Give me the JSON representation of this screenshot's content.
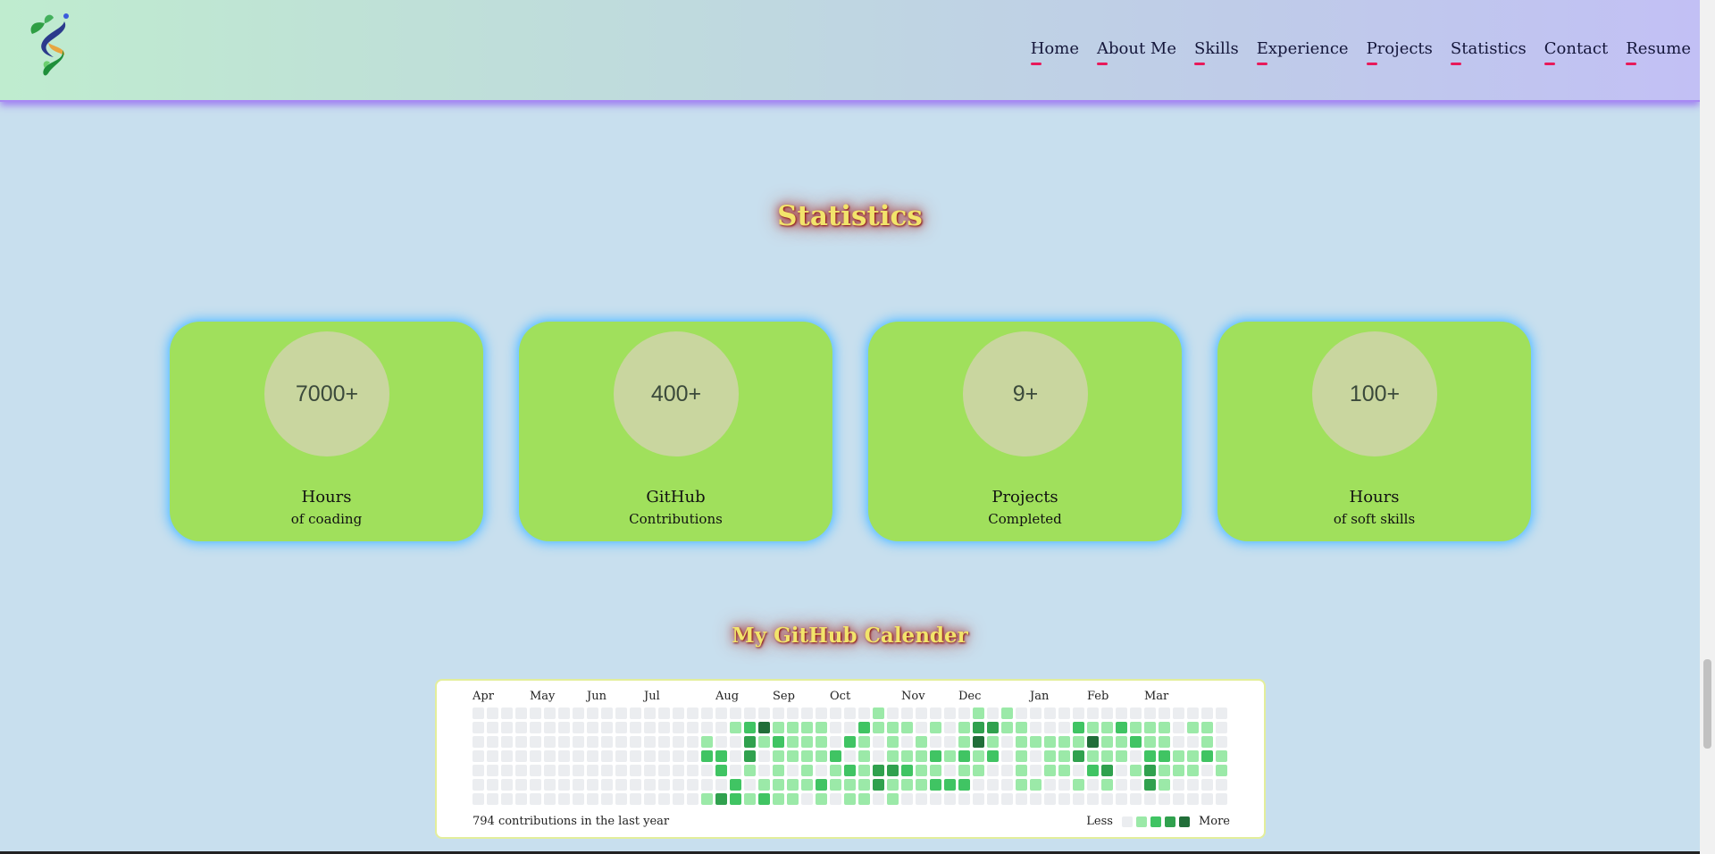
{
  "nav": {
    "items": [
      "Home",
      "About Me",
      "Skills",
      "Experience",
      "Projects",
      "Statistics",
      "Contact",
      "Resume"
    ]
  },
  "statistics": {
    "title": "Statistics",
    "cards": [
      {
        "value": "7000+",
        "title": "Hours",
        "sub": "of coading"
      },
      {
        "value": "400+",
        "title": "GitHub",
        "sub": "Contributions"
      },
      {
        "value": "9+",
        "title": "Projects",
        "sub": "Completed"
      },
      {
        "value": "100+",
        "title": "Hours",
        "sub": "of soft skills"
      }
    ]
  },
  "calendar": {
    "title": "My GitHub Calender",
    "months": [
      "Apr",
      "May",
      "Jun",
      "Jul",
      "Aug",
      "Sep",
      "Oct",
      "Nov",
      "Dec",
      "Jan",
      "Feb",
      "Mar"
    ],
    "month_weeks": [
      0,
      4,
      8,
      12,
      17,
      21,
      25,
      30,
      34,
      39,
      43,
      47
    ],
    "summary": "794 contributions in the last year",
    "legend_less": "Less",
    "legend_more": "More",
    "colors": [
      "#ebedf0",
      "#9be9a8",
      "#40c463",
      "#30a14e",
      "#216e39"
    ],
    "active_weeks_pattern": [
      [
        0,
        0,
        0,
        0,
        0,
        0,
        0
      ],
      [
        0,
        0,
        0,
        0,
        0,
        0,
        0
      ],
      [
        0,
        0,
        0,
        0,
        0,
        0,
        0
      ],
      [
        0,
        0,
        0,
        0,
        0,
        0,
        0
      ],
      [
        0,
        0,
        0,
        0,
        0,
        0,
        0
      ],
      [
        0,
        0,
        0,
        0,
        0,
        0,
        0
      ],
      [
        0,
        0,
        0,
        0,
        0,
        0,
        0
      ],
      [
        0,
        0,
        0,
        0,
        0,
        0,
        0
      ],
      [
        0,
        0,
        0,
        0,
        0,
        0,
        0
      ],
      [
        0,
        0,
        0,
        0,
        0,
        0,
        0
      ],
      [
        0,
        0,
        0,
        0,
        0,
        0,
        0
      ],
      [
        0,
        0,
        0,
        0,
        0,
        0,
        0
      ],
      [
        0,
        0,
        0,
        0,
        0,
        0,
        0
      ],
      [
        0,
        0,
        0,
        0,
        0,
        0,
        0
      ],
      [
        0,
        0,
        0,
        0,
        0,
        0,
        0
      ],
      [
        0,
        0,
        0,
        0,
        0,
        0,
        0
      ],
      [
        0,
        0,
        1,
        2,
        0,
        0,
        1
      ],
      [
        0,
        0,
        0,
        2,
        2,
        0,
        3
      ],
      [
        0,
        1,
        0,
        0,
        0,
        2,
        2
      ],
      [
        0,
        2,
        3,
        3,
        1,
        0,
        1
      ],
      [
        0,
        4,
        1,
        0,
        0,
        1,
        2
      ],
      [
        0,
        1,
        2,
        1,
        1,
        1,
        1
      ],
      [
        0,
        1,
        1,
        1,
        0,
        1,
        1
      ],
      [
        0,
        1,
        1,
        1,
        1,
        1,
        0
      ],
      [
        0,
        1,
        1,
        1,
        0,
        2,
        1
      ],
      [
        0,
        0,
        0,
        2,
        1,
        1,
        0
      ],
      [
        0,
        0,
        2,
        0,
        2,
        1,
        1
      ],
      [
        0,
        2,
        1,
        1,
        1,
        1,
        1
      ],
      [
        1,
        1,
        0,
        0,
        3,
        3,
        0
      ],
      [
        0,
        1,
        1,
        1,
        3,
        1,
        1
      ],
      [
        0,
        1,
        0,
        1,
        2,
        1,
        0
      ],
      [
        0,
        0,
        1,
        1,
        1,
        1,
        0
      ],
      [
        0,
        1,
        0,
        2,
        1,
        2,
        0
      ],
      [
        0,
        0,
        0,
        1,
        0,
        2,
        0
      ],
      [
        0,
        1,
        1,
        2,
        1,
        2,
        0
      ],
      [
        1,
        3,
        4,
        1,
        1,
        0,
        0
      ],
      [
        0,
        3,
        1,
        2,
        0,
        0,
        0
      ],
      [
        1,
        1,
        0,
        0,
        0,
        0,
        0
      ],
      [
        0,
        1,
        1,
        1,
        1,
        1,
        0
      ],
      [
        0,
        0,
        1,
        0,
        0,
        1,
        0
      ],
      [
        0,
        0,
        1,
        1,
        1,
        0,
        0
      ],
      [
        0,
        0,
        1,
        1,
        1,
        0,
        0
      ],
      [
        0,
        2,
        1,
        3,
        0,
        1,
        0
      ],
      [
        0,
        1,
        4,
        1,
        2,
        0,
        0
      ],
      [
        0,
        1,
        1,
        1,
        3,
        1,
        0
      ],
      [
        0,
        2,
        1,
        1,
        0,
        0,
        0
      ],
      [
        0,
        1,
        2,
        0,
        1,
        0,
        0
      ],
      [
        0,
        1,
        1,
        2,
        3,
        3,
        0
      ],
      [
        0,
        1,
        1,
        2,
        1,
        1,
        0
      ],
      [
        0,
        0,
        0,
        1,
        1,
        0,
        0
      ],
      [
        0,
        1,
        0,
        1,
        1,
        0,
        0
      ],
      [
        0,
        1,
        1,
        2,
        0,
        0,
        0
      ],
      [
        0,
        0,
        0,
        1,
        1,
        0,
        0
      ]
    ]
  }
}
